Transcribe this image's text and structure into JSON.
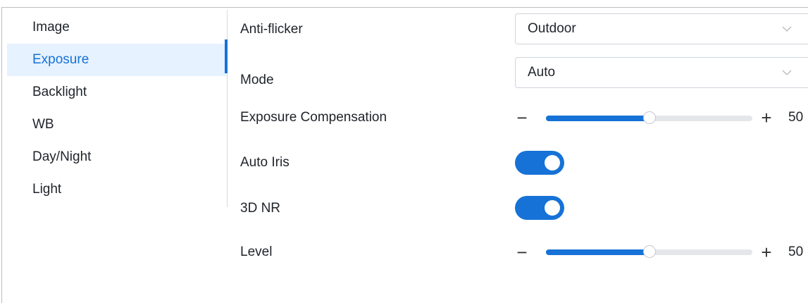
{
  "sidebar": {
    "items": [
      {
        "label": "Image"
      },
      {
        "label": "Exposure",
        "active": true
      },
      {
        "label": "Backlight"
      },
      {
        "label": "WB"
      },
      {
        "label": "Day/Night"
      },
      {
        "label": "Light"
      }
    ]
  },
  "form": {
    "anti_flicker": {
      "label": "Anti-flicker",
      "value": "Outdoor"
    },
    "mode": {
      "label": "Mode",
      "value": "Auto"
    },
    "exposure_compensation": {
      "label": "Exposure Compensation",
      "value": "50",
      "minus": "−",
      "plus": "+",
      "level": 0.5
    },
    "auto_iris": {
      "label": "Auto Iris",
      "on": true
    },
    "nr3d": {
      "label": "3D NR",
      "on": true
    },
    "level": {
      "label": "Level",
      "value": "50",
      "minus": "−",
      "plus": "+",
      "level": 0.5
    }
  },
  "colors": {
    "accent": "#1672d6",
    "active_bg": "#e6f2ff",
    "track": "#e4e6ea"
  },
  "icons": {
    "select_arrow": "chevron-down-icon"
  }
}
